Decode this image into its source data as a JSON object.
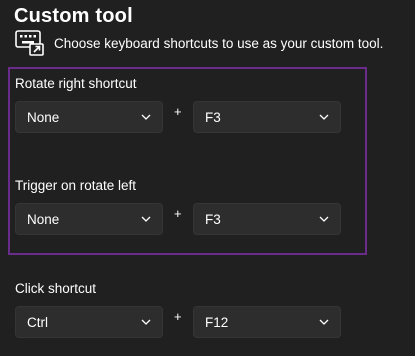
{
  "header": {
    "title": "Custom tool",
    "description": "Choose keyboard shortcuts to use as your custom tool."
  },
  "sections": [
    {
      "label": "Rotate right shortcut",
      "modifier": "None",
      "plus": "+",
      "key": "F3"
    },
    {
      "label": "Trigger on rotate left",
      "modifier": "None",
      "plus": "+",
      "key": "F3"
    },
    {
      "label": "Click shortcut",
      "modifier": "Ctrl",
      "plus": "+",
      "key": "F12"
    }
  ],
  "colors": {
    "background": "#202020",
    "dropdown_bg": "#2d2d2d",
    "highlight": "#6a2c8a"
  },
  "icons": {
    "header_icon": "keyboard-shortcut-icon",
    "dropdown_icon": "chevron-down-icon"
  }
}
